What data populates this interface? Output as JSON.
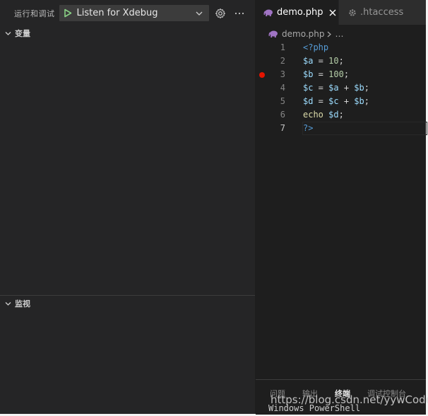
{
  "debug_sidebar": {
    "run_title": "运行和调试",
    "config_name": "Listen for Xdebug",
    "sections": {
      "variables": "变量",
      "watch": "监视"
    }
  },
  "editor": {
    "tabs": [
      {
        "label": "demo.php",
        "active": true
      },
      {
        "label": ".htaccess",
        "active": false
      }
    ],
    "breadcrumb": {
      "file": "demo.php",
      "rest": "…"
    },
    "line_numbers": [
      "1",
      "2",
      "3",
      "4",
      "5",
      "6",
      "7"
    ],
    "breakpoint_line": 3,
    "current_line": 7,
    "lines": [
      [
        {
          "t": "<?php",
          "c": "tag"
        }
      ],
      [
        {
          "t": "$a",
          "c": "var"
        },
        {
          "t": " = ",
          "c": "op"
        },
        {
          "t": "10",
          "c": "num"
        },
        {
          "t": ";",
          "c": "op"
        }
      ],
      [
        {
          "t": "$b",
          "c": "var"
        },
        {
          "t": " = ",
          "c": "op"
        },
        {
          "t": "100",
          "c": "num"
        },
        {
          "t": ";",
          "c": "op"
        }
      ],
      [
        {
          "t": "$c",
          "c": "var"
        },
        {
          "t": " = ",
          "c": "op"
        },
        {
          "t": "$a",
          "c": "var"
        },
        {
          "t": " + ",
          "c": "op"
        },
        {
          "t": "$b",
          "c": "var"
        },
        {
          "t": ";",
          "c": "op"
        }
      ],
      [
        {
          "t": "$d",
          "c": "var"
        },
        {
          "t": " = ",
          "c": "op"
        },
        {
          "t": "$c",
          "c": "var"
        },
        {
          "t": " + ",
          "c": "op"
        },
        {
          "t": "$b",
          "c": "var"
        },
        {
          "t": ";",
          "c": "op"
        }
      ],
      [
        {
          "t": "echo",
          "c": "kw"
        },
        {
          "t": " ",
          "c": "op"
        },
        {
          "t": "$d",
          "c": "var"
        },
        {
          "t": ";",
          "c": "op"
        }
      ],
      [
        {
          "t": "?>",
          "c": "tag"
        }
      ]
    ]
  },
  "panel": {
    "tabs": [
      "问题",
      "输出",
      "终端",
      "调试控制台"
    ],
    "active_tab": "终端",
    "terminal_text": "Windows PowerShell"
  },
  "watermark": "https://blog.csdn.net/yywCode",
  "colors": {
    "accent_play": "#89d185",
    "breakpoint": "#e51400",
    "php_icon": "#a074c4"
  }
}
